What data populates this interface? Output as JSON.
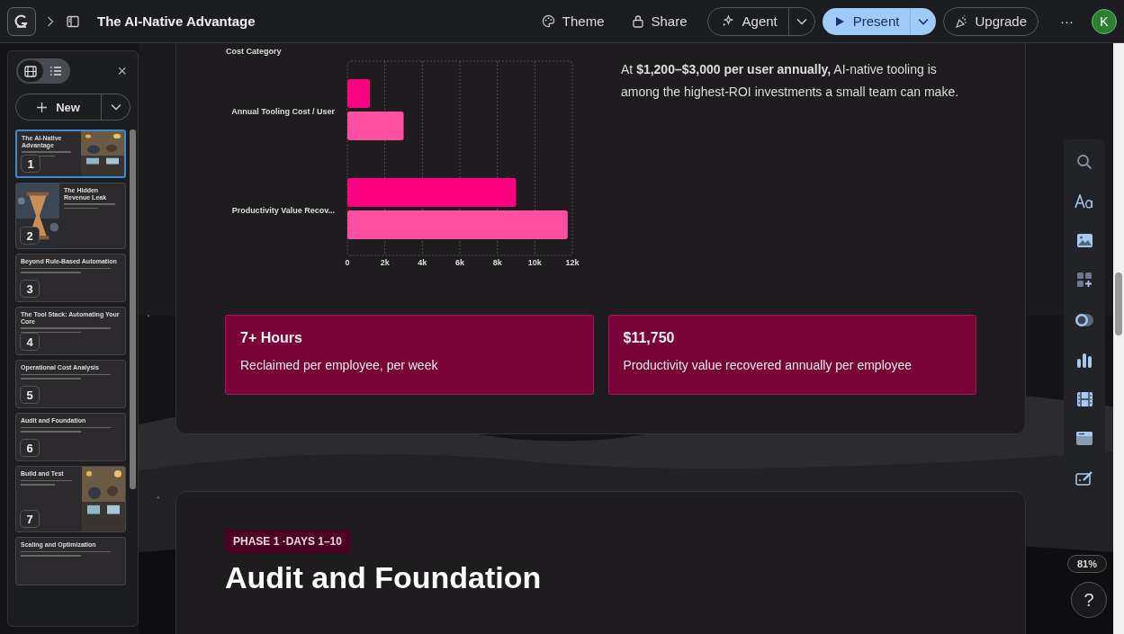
{
  "topbar": {
    "title": "The AI-Native Advantage",
    "actions": [
      {
        "kind": "theme",
        "label": "Theme"
      },
      {
        "kind": "share",
        "label": "Share"
      }
    ],
    "agent": "Agent",
    "present": "Present",
    "upgrade": "Upgrade",
    "more": "···",
    "avatar": "K"
  },
  "sidebar": {
    "views": [
      {
        "kind": "grid",
        "selected": true
      },
      {
        "kind": "list",
        "selected": false
      }
    ],
    "close": "×",
    "new": "New",
    "slides": [
      {
        "number": "1",
        "title": "The AI-Native Advantage",
        "kind": "imageright",
        "selected": true
      },
      {
        "number": "2",
        "title": "The Hidden Revenue Leak",
        "kind": "imageleft",
        "selected": false
      },
      {
        "number": "3",
        "title": "Beyond Rule-Based Automation",
        "kind": "text",
        "selected": false
      },
      {
        "number": "4",
        "title": "The Tool Stack: Automating Your Core",
        "kind": "text",
        "selected": false
      },
      {
        "number": "5",
        "title": "Operational Cost Analysis",
        "kind": "text",
        "selected": false
      },
      {
        "number": "6",
        "title": "Audit and Foundation",
        "kind": "text",
        "selected": false
      },
      {
        "number": "7",
        "title": "Build and Test",
        "kind": "imageright",
        "selected": false
      },
      {
        "title": "Scaling and Optimization",
        "kind": "text",
        "selected": false
      }
    ]
  },
  "card": {
    "chart_data": {
      "type": "bar",
      "orientation": "horizontal",
      "grid": true,
      "ylabel": "Cost Category",
      "categories": [
        "Annual Tooling Cost / User",
        "Productivity Value Recov..."
      ],
      "series": [
        {
          "color": "#ff0080",
          "values": [
            1200,
            9000
          ]
        },
        {
          "color": "#ff4fa0",
          "values": [
            3000,
            11750
          ]
        }
      ],
      "xlim": [
        0,
        12000
      ],
      "xticks": [
        {
          "value": 0,
          "label": "0"
        },
        {
          "value": 2000,
          "label": "2k"
        },
        {
          "value": 4000,
          "label": "4k"
        },
        {
          "value": 6000,
          "label": "6k"
        },
        {
          "value": 8000,
          "label": "8k"
        },
        {
          "value": 10000,
          "label": "10k"
        },
        {
          "value": 12000,
          "label": "12k"
        }
      ]
    },
    "text": "At **$1,200–$3,000 per user annually,** AI-native tooling is among the highest-ROI investments a small team can make.",
    "stats": [
      {
        "value": "7+ Hours",
        "caption": "Reclaimed per employee, per week"
      },
      {
        "value": "$11,750",
        "caption": "Productivity value recovered annually per employee"
      }
    ]
  },
  "next_card": {
    "tag": "PHASE 1 ·DAYS 1–10",
    "title": "Audit and Foundation"
  },
  "zoom": "81%",
  "help": "?"
}
